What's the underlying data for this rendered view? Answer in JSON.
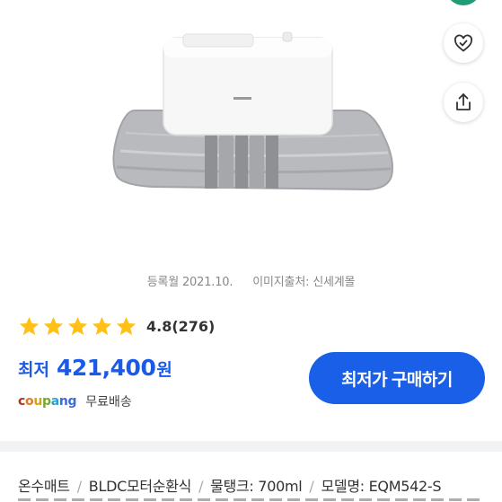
{
  "header": {
    "fab_color": "#1f9b77"
  },
  "actions": {
    "wish_icon": "heart-check-icon",
    "share_icon": "share-icon"
  },
  "product": {
    "image_alt": "온수매트",
    "registered": "등록월 2021.10.",
    "image_source": "이미지출처: 신세계몰"
  },
  "rating": {
    "stars": 5,
    "score": "4.8",
    "count": "(276)"
  },
  "price": {
    "label": "최저",
    "value": "421,400",
    "unit": "원",
    "color": "#1a5ae6"
  },
  "seller": {
    "logo": {
      "c1": "c",
      "c2": "o",
      "c3": "u",
      "c4": "p",
      "c5": "a",
      "c6": "ng"
    },
    "shipping": "무료배송"
  },
  "buy_button": {
    "label": "최저가 구매하기",
    "color": "#1a5fe8"
  },
  "specs": {
    "items": [
      "온수매트",
      "BLDC모터순환식",
      "물탱크: 700ml",
      "모델명: EQM542-S"
    ],
    "separator": "/"
  }
}
